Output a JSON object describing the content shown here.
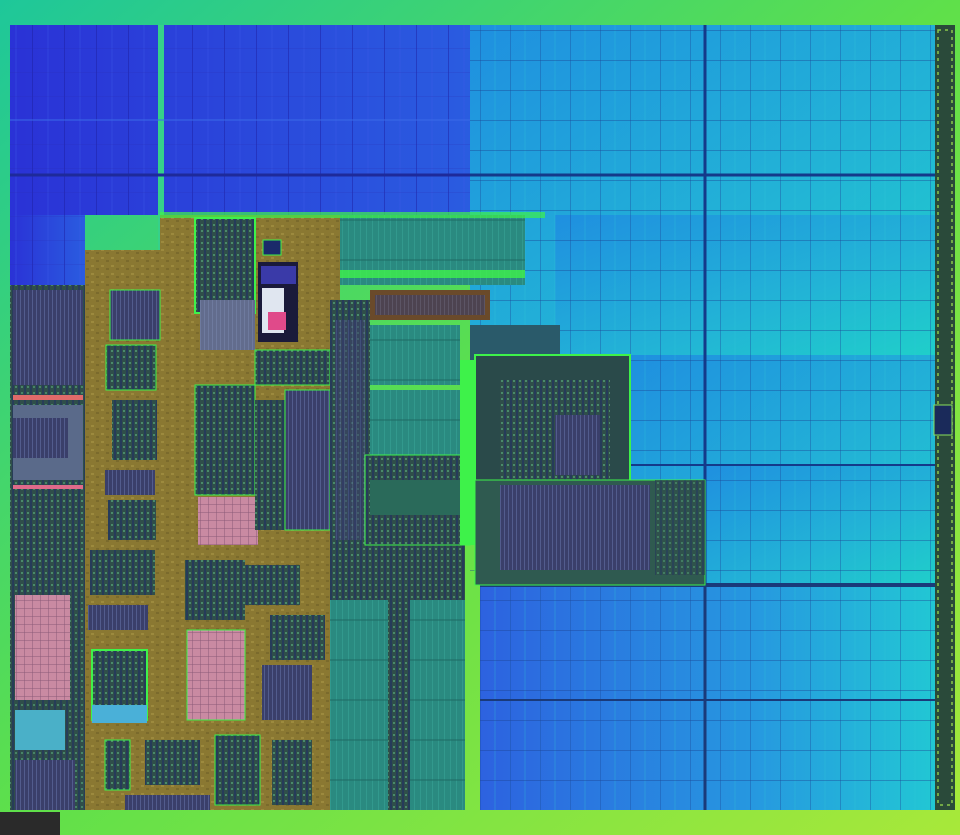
{
  "image": {
    "subject": "die-photo",
    "palette": {
      "frame": "#5fe04a",
      "cache_left": "#2f3fd8",
      "cache_right": "#23b2cf",
      "logic_gold": "#8d7a33",
      "logic_dark": "#2f4a43",
      "teal_blocks": "#2a8c7c",
      "highlight_green": "#3ef24a",
      "pink_cells": "#d08aa0"
    }
  }
}
